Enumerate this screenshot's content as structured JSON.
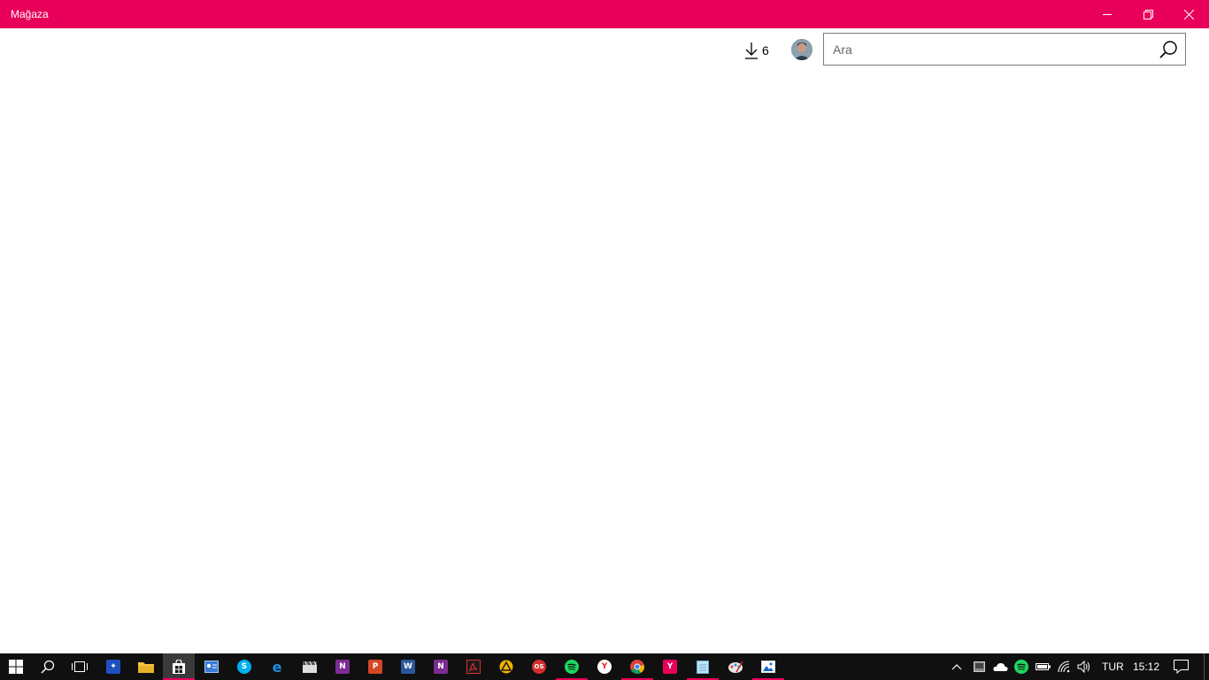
{
  "window": {
    "title": "Mağaza"
  },
  "header": {
    "downloads_count": "6",
    "search": {
      "placeholder": "Ara",
      "value": ""
    }
  },
  "taskbar": {
    "apps": [
      {
        "name": "start",
        "icon": "windows-logo-icon"
      },
      {
        "name": "search",
        "icon": "search-icon"
      },
      {
        "name": "task-view",
        "icon": "task-view-icon"
      },
      {
        "name": "app-blue",
        "icon": "app-blue-icon"
      },
      {
        "name": "file-explorer",
        "icon": "folder-icon"
      },
      {
        "name": "store",
        "icon": "store-icon",
        "active": true
      },
      {
        "name": "contacts",
        "icon": "contact-card-icon"
      },
      {
        "name": "skype",
        "icon": "skype-icon",
        "letter": "S"
      },
      {
        "name": "edge",
        "icon": "edge-icon",
        "letter": "e"
      },
      {
        "name": "movie-maker",
        "icon": "clapperboard-icon"
      },
      {
        "name": "onenote",
        "icon": "onenote-icon",
        "letter": "N"
      },
      {
        "name": "powerpoint",
        "icon": "powerpoint-icon",
        "letter": "P"
      },
      {
        "name": "word",
        "icon": "word-icon",
        "letter": "W"
      },
      {
        "name": "onenote-2",
        "icon": "onenote-icon",
        "letter": "N"
      },
      {
        "name": "acrobat",
        "icon": "acrobat-icon"
      },
      {
        "name": "app-yellow",
        "icon": "triangle-app-icon"
      },
      {
        "name": "app-os",
        "icon": "os-app-icon",
        "letter": "OS"
      },
      {
        "name": "spotify",
        "icon": "spotify-icon",
        "running": true
      },
      {
        "name": "yandex",
        "icon": "yandex-icon",
        "letter": "Y"
      },
      {
        "name": "chrome",
        "icon": "chrome-icon",
        "running": true
      },
      {
        "name": "app-y-pink",
        "icon": "y-app-icon",
        "letter": "Y",
        "running": true
      },
      {
        "name": "notepad",
        "icon": "notepad-icon",
        "running": true
      },
      {
        "name": "paint",
        "icon": "paint-icon"
      },
      {
        "name": "photos",
        "icon": "photos-icon",
        "running": true
      }
    ],
    "tray": {
      "language": "TUR",
      "time": "15:12"
    }
  },
  "colors": {
    "accent": "#e8005a",
    "taskbar": "#101010"
  }
}
